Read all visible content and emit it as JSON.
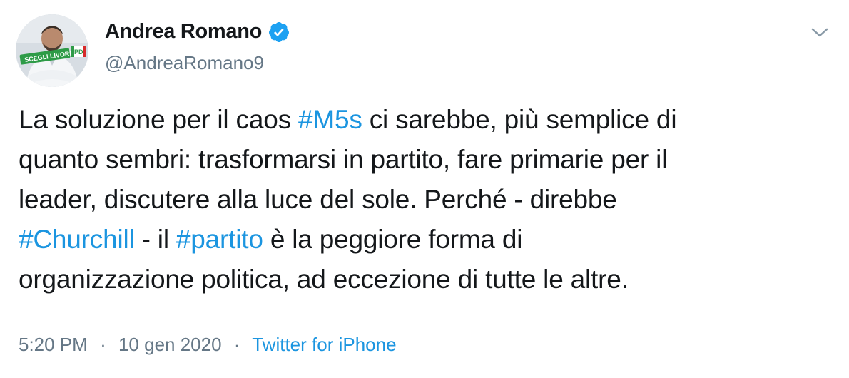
{
  "user": {
    "display_name": "Andrea Romano",
    "handle": "@AndreaRomano9",
    "verified": true,
    "avatar_badge_text": "SCEGLI LIVORNO",
    "avatar_logo_text": "PD"
  },
  "tweet": {
    "lines": [
      [
        {
          "t": "La soluzione per il caos "
        },
        {
          "t": "#M5s",
          "tag": true
        },
        {
          "t": " ci sarebbe, più semplice di"
        }
      ],
      [
        {
          "t": "quanto sembri: trasformarsi in partito, fare primarie per il"
        }
      ],
      [
        {
          "t": "leader, discutere alla luce del sole. Perché - direbbe"
        }
      ],
      [
        {
          "t": "#Churchill",
          "tag": true
        },
        {
          "t": " - il "
        },
        {
          "t": "#partito",
          "tag": true
        },
        {
          "t": " è la peggiore forma di"
        }
      ],
      [
        {
          "t": "organizzazione politica, ad eccezione di tutte le altre."
        }
      ]
    ]
  },
  "meta": {
    "time": "5:20 PM",
    "separator": "·",
    "date": "10 gen 2020",
    "source": "Twitter for iPhone"
  },
  "icons": {
    "verified": "verified-badge-icon",
    "caret": "chevron-down-icon"
  },
  "colors": {
    "text": "#14171a",
    "secondary": "#657786",
    "link": "#1b95e0",
    "verified": "#1da1f2"
  }
}
